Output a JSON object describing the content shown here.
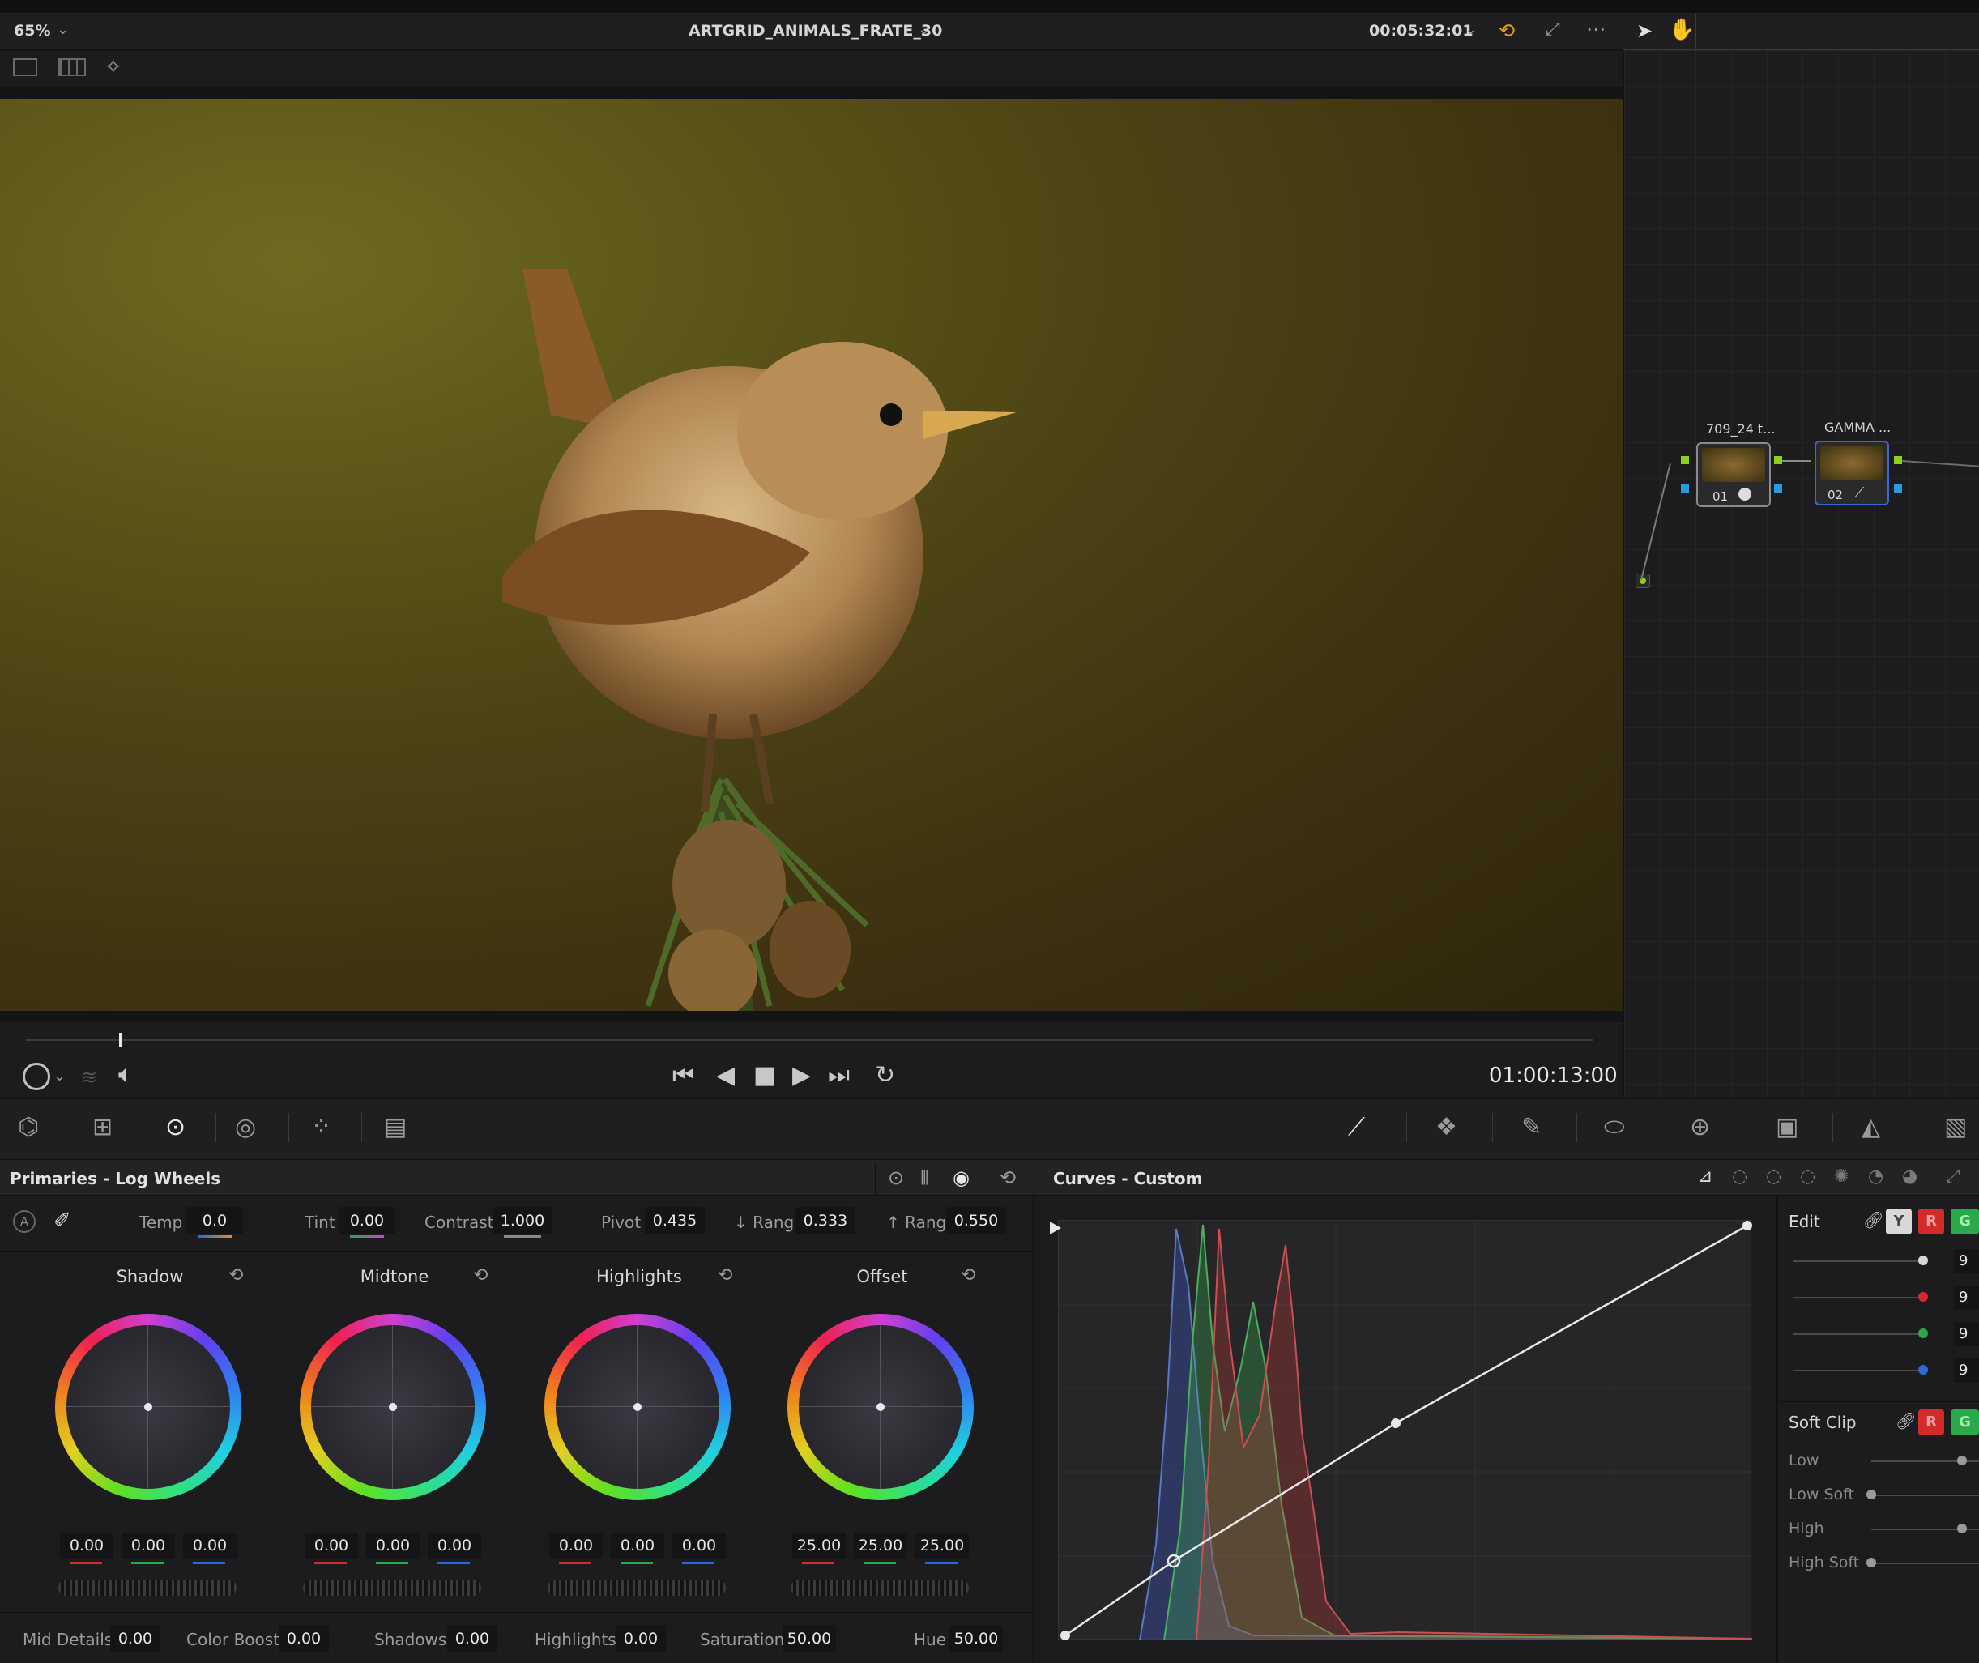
{
  "viewer": {
    "zoom": "65%",
    "clip_name": "ARTGRID_ANIMALS_FRATE_30",
    "timecode_top": "00:05:32:01",
    "timecode_playback": "01:00:13:00"
  },
  "nodes": [
    {
      "label": "709_24 t...",
      "number": "01"
    },
    {
      "label": "GAMMA ...",
      "number": "02"
    }
  ],
  "primaries": {
    "title": "Primaries - Log Wheels",
    "temp_label": "Temp",
    "temp": "0.0",
    "tint_label": "Tint",
    "tint": "0.00",
    "contrast_label": "Contrast",
    "contrast": "1.000",
    "pivot_label": "Pivot",
    "pivot": "0.435",
    "low_range_label": "↓ Range",
    "low_range": "0.333",
    "high_range_label": "↑ Range",
    "high_range": "0.550",
    "wheels": [
      {
        "name": "Shadow",
        "values": [
          "0.00",
          "0.00",
          "0.00"
        ]
      },
      {
        "name": "Midtone",
        "values": [
          "0.00",
          "0.00",
          "0.00"
        ]
      },
      {
        "name": "Highlights",
        "values": [
          "0.00",
          "0.00",
          "0.00"
        ]
      },
      {
        "name": "Offset",
        "values": [
          "25.00",
          "25.00",
          "25.00"
        ]
      }
    ],
    "bottom": [
      {
        "label": "Mid Details",
        "value": "0.00"
      },
      {
        "label": "Color Boost",
        "value": "0.00"
      },
      {
        "label": "Shadows",
        "value": "0.00"
      },
      {
        "label": "Highlights",
        "value": "0.00"
      },
      {
        "label": "Saturation",
        "value": "50.00"
      },
      {
        "label": "Hue",
        "value": "50.00"
      }
    ]
  },
  "curves": {
    "title": "Curves - Custom",
    "edit_label": "Edit",
    "soft_clip_label": "Soft Clip",
    "channels": [
      "Y",
      "R",
      "G"
    ],
    "soft_clip_items": [
      "Low",
      "Low Soft",
      "High",
      "High Soft"
    ],
    "edit_values": [
      "9",
      "9",
      "9",
      "9"
    ]
  },
  "colors": {
    "accent_red": "#d42a2a",
    "accent_green": "#2aa84a",
    "accent_blue": "#2a6ad4"
  }
}
